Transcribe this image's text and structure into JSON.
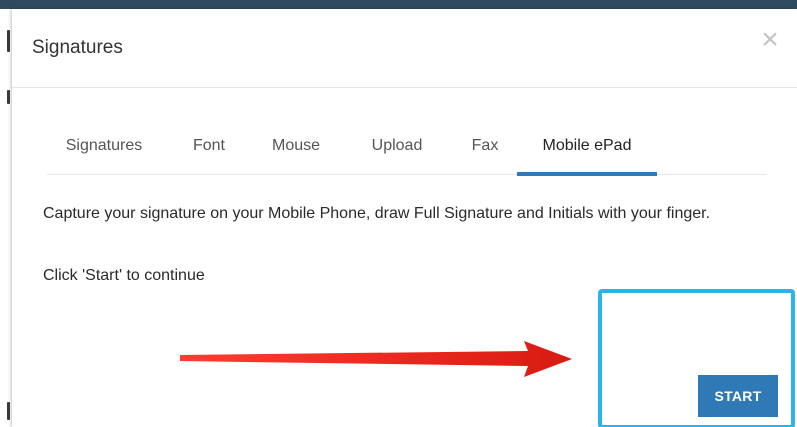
{
  "colors": {
    "accent": "#2f79b6",
    "highlight_border": "#29b5e8",
    "arrow": "#e8241c",
    "page_strip": "#2f4a5e"
  },
  "modal": {
    "title": "Signatures",
    "close_icon": "close-icon",
    "close_glyph": "×"
  },
  "tabs": [
    {
      "label": "Signatures",
      "active": false
    },
    {
      "label": "Font",
      "active": false
    },
    {
      "label": "Mouse",
      "active": false
    },
    {
      "label": "Upload",
      "active": false
    },
    {
      "label": "Fax",
      "active": false
    },
    {
      "label": "Mobile ePad",
      "active": true
    }
  ],
  "content": {
    "instruction": "Capture your signature on your Mobile Phone, draw Full Signature and Initials with your finger.",
    "prompt": "Click 'Start' to continue"
  },
  "actions": {
    "start_label": "START"
  },
  "annotation": {
    "arrow_icon": "arrow-right-icon"
  }
}
